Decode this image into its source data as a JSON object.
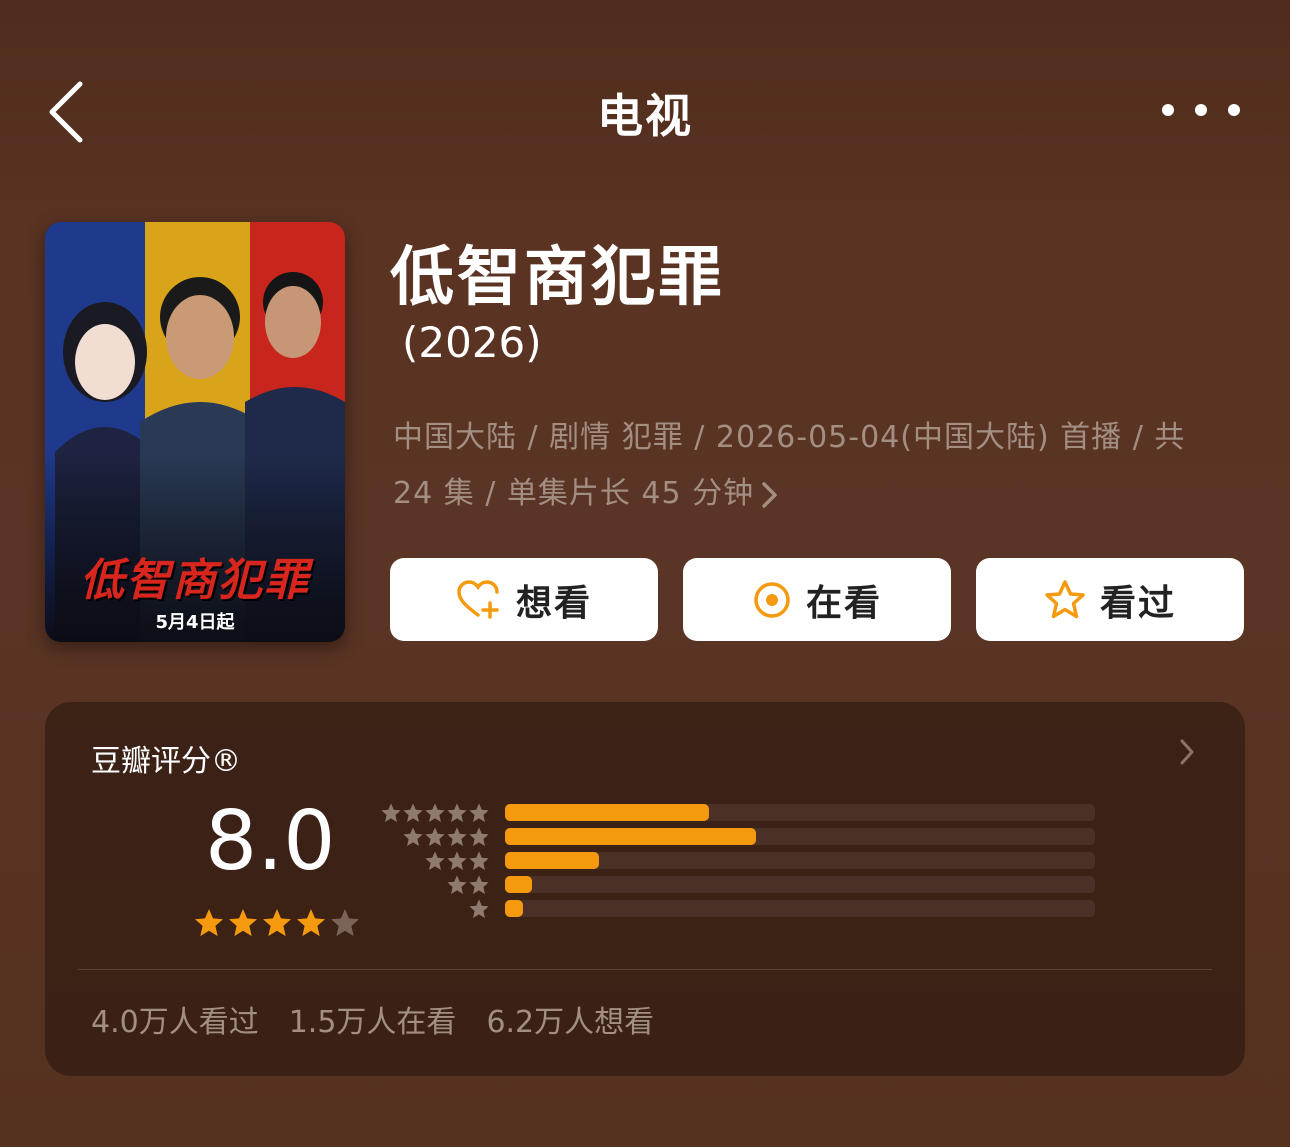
{
  "nav": {
    "title": "电视"
  },
  "poster": {
    "title_text": "低智商犯罪",
    "date_text": "5月4日起",
    "colors": [
      "#1f3a8c",
      "#d9a419",
      "#c8261d"
    ]
  },
  "show": {
    "title": "低智商犯罪",
    "year": "(2026)",
    "meta_line1": "中国大陆 / 剧情 犯罪 / 2026-05-04(中国大陆) 首播 / 共",
    "meta_line2": "24 集 / 单集片长 45 分钟"
  },
  "actions": [
    {
      "label": "想看",
      "icon": "heart-plus-icon"
    },
    {
      "label": "在看",
      "icon": "target-icon"
    },
    {
      "label": "看过",
      "icon": "star-outline-icon"
    }
  ],
  "rating": {
    "label": "豆瓣评分®",
    "score": "8.0",
    "score_stars": 4,
    "distribution": [
      {
        "stars": 5,
        "fraction": 0.345
      },
      {
        "stars": 4,
        "fraction": 0.425
      },
      {
        "stars": 3,
        "fraction": 0.16
      },
      {
        "stars": 2,
        "fraction": 0.045
      },
      {
        "stars": 1,
        "fraction": 0.03
      }
    ],
    "stats": [
      "4.0万人看过",
      "1.5万人在看",
      "6.2万人想看"
    ]
  },
  "colors": {
    "accent": "#f59a0e",
    "muted_text": "#a38e82"
  }
}
